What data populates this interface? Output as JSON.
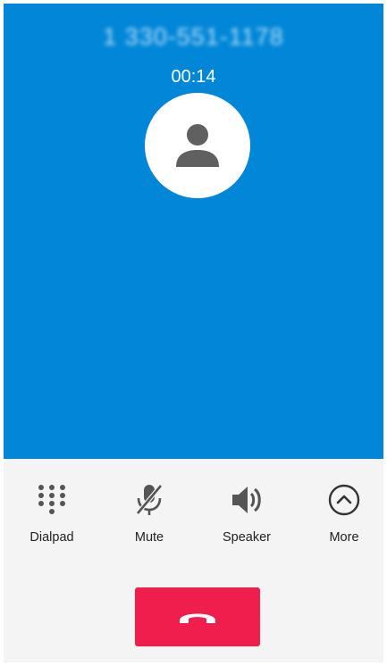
{
  "call": {
    "number": "1 330-551-1178",
    "timer": "00:14"
  },
  "controls": [
    {
      "label": "Dialpad",
      "icon": "dialpad-icon"
    },
    {
      "label": "Mute",
      "icon": "mic-off-icon"
    },
    {
      "label": "Speaker",
      "icon": "speaker-icon"
    },
    {
      "label": "More",
      "icon": "chevron-up-circle-icon"
    }
  ],
  "end_call": {
    "icon": "hang-up-icon"
  },
  "colors": {
    "call_background": "#0287d8",
    "end_call_button": "#f01e4d",
    "control_icon": "#555555",
    "avatar_icon": "#606060"
  }
}
